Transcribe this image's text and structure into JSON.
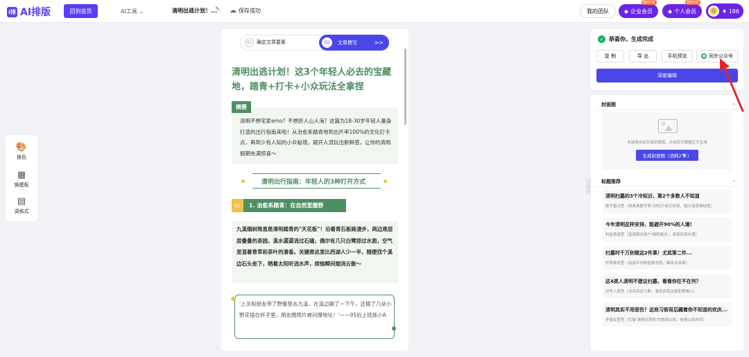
{
  "app": {
    "logo_mark": "i排",
    "logo_text": "AI排版"
  },
  "header": {
    "home_label": "回到首页",
    "ai_tools_label": "AI工具",
    "doc_title": "清明出逃计划！...",
    "save_status": "保存成功",
    "team_label": "我的团队",
    "enterprise_label": "企业会员",
    "enterprise_tag": "限时5折",
    "personal_label": "个人会员",
    "personal_tag": "限时5折",
    "credits": "186"
  },
  "left_tools": [
    {
      "icon": "palette-icon",
      "label": "换色"
    },
    {
      "icon": "template-icon",
      "label": "换模板"
    },
    {
      "icon": "format-icon",
      "label": "调格式"
    }
  ],
  "steps": {
    "step1_num": "01",
    "step1_label": "确定文章要素",
    "step2_num": "02",
    "step2_label": "文章撰写",
    "arrows": ">>"
  },
  "article": {
    "title": "清明出逃计划！这3个年轻人必去的宝藏地，踏青+打卡+小众玩法全拿捏",
    "summary_tag": "摘要",
    "summary": "清明不想宅家emo？不想挤人山人海？这篇为18-30岁年轻人量身打造的出行指南来啦！从治愈系踏青地到出片率100%的文化打卡点，再到少有人知的小众秘境，避开人流玩出新鲜感，让你的清明假期充满惊喜～",
    "section_title": "清明出行指南：年轻人的3种打开方式",
    "sub_num": "01",
    "sub_title": "1. 治愈系踏青：在自然里撒野",
    "body": "九溪烟树简直是清明踏青的\"天花板\"！沿着青石板路漫步，两边是层层叠叠的茶园，溪水潺潺流过石缝，偶尔有几只白鹭掠过水面，空气里混着青草和茶叶的清香。关键是这里比西湖人少一半，随便找个溪边石头坐下，晒着太阳听流水声，烦恼瞬间烟消云散～",
    "quote": "'上次和朋友带了野餐垫去九溪，在溪边躺了一下午，还摘了几朵小野花插在杯子里，朋友圈照片被问爆地址！'——95后上班族小A"
  },
  "right_top": {
    "done_label": "恭喜你，生成完成",
    "copy_label": "复 制",
    "export_label": "导 出",
    "preview_label": "手机预览",
    "sync_label": "同步公众号",
    "deep_edit_label": "深度编辑"
  },
  "cover": {
    "header": "封面图",
    "hint": "未选择自动生成封面图，点击后可根据正文生成",
    "button": "生成封面图（消耗2💎）"
  },
  "titles": {
    "header": "标题推荐",
    "items": [
      {
        "title": "清明扫墓的3个冷知识，第2个多数人不知道",
        "sub": "数字盘点型（用具体数字和'冷知识'吸引好奇，暗示信息稀缺性）"
      },
      {
        "title": "今年清明这样安排，能避开90%的人潮！",
        "sub": "利益承诺型（直接解决用户'拥挤痛点'，承诺实用价值）"
      },
      {
        "title": "扫墓时千万别做这2件事！尤其第二件...",
        "sub": "好奇悬念型（话留半句制造悬念感，触发点击欲）"
      },
      {
        "title": "这4类人清明不建议扫墓，看看你在不在列？",
        "sub": "对号入座型（点名特定人群，激发自我关联和警惕心）"
      },
      {
        "title": "清明其实不用悲伤？这些习俗背后藏着你不知道的欢庆...",
        "sub": "矛盾反差型（打破'清明必悲伤'的常规认知，制造认知冲突）"
      }
    ]
  },
  "colors": {
    "accent": "#4b46e8",
    "brand": "#5b3df5",
    "article_green": "#4d8f62",
    "gold": "#f3c046",
    "vip": "#6a24e8"
  }
}
